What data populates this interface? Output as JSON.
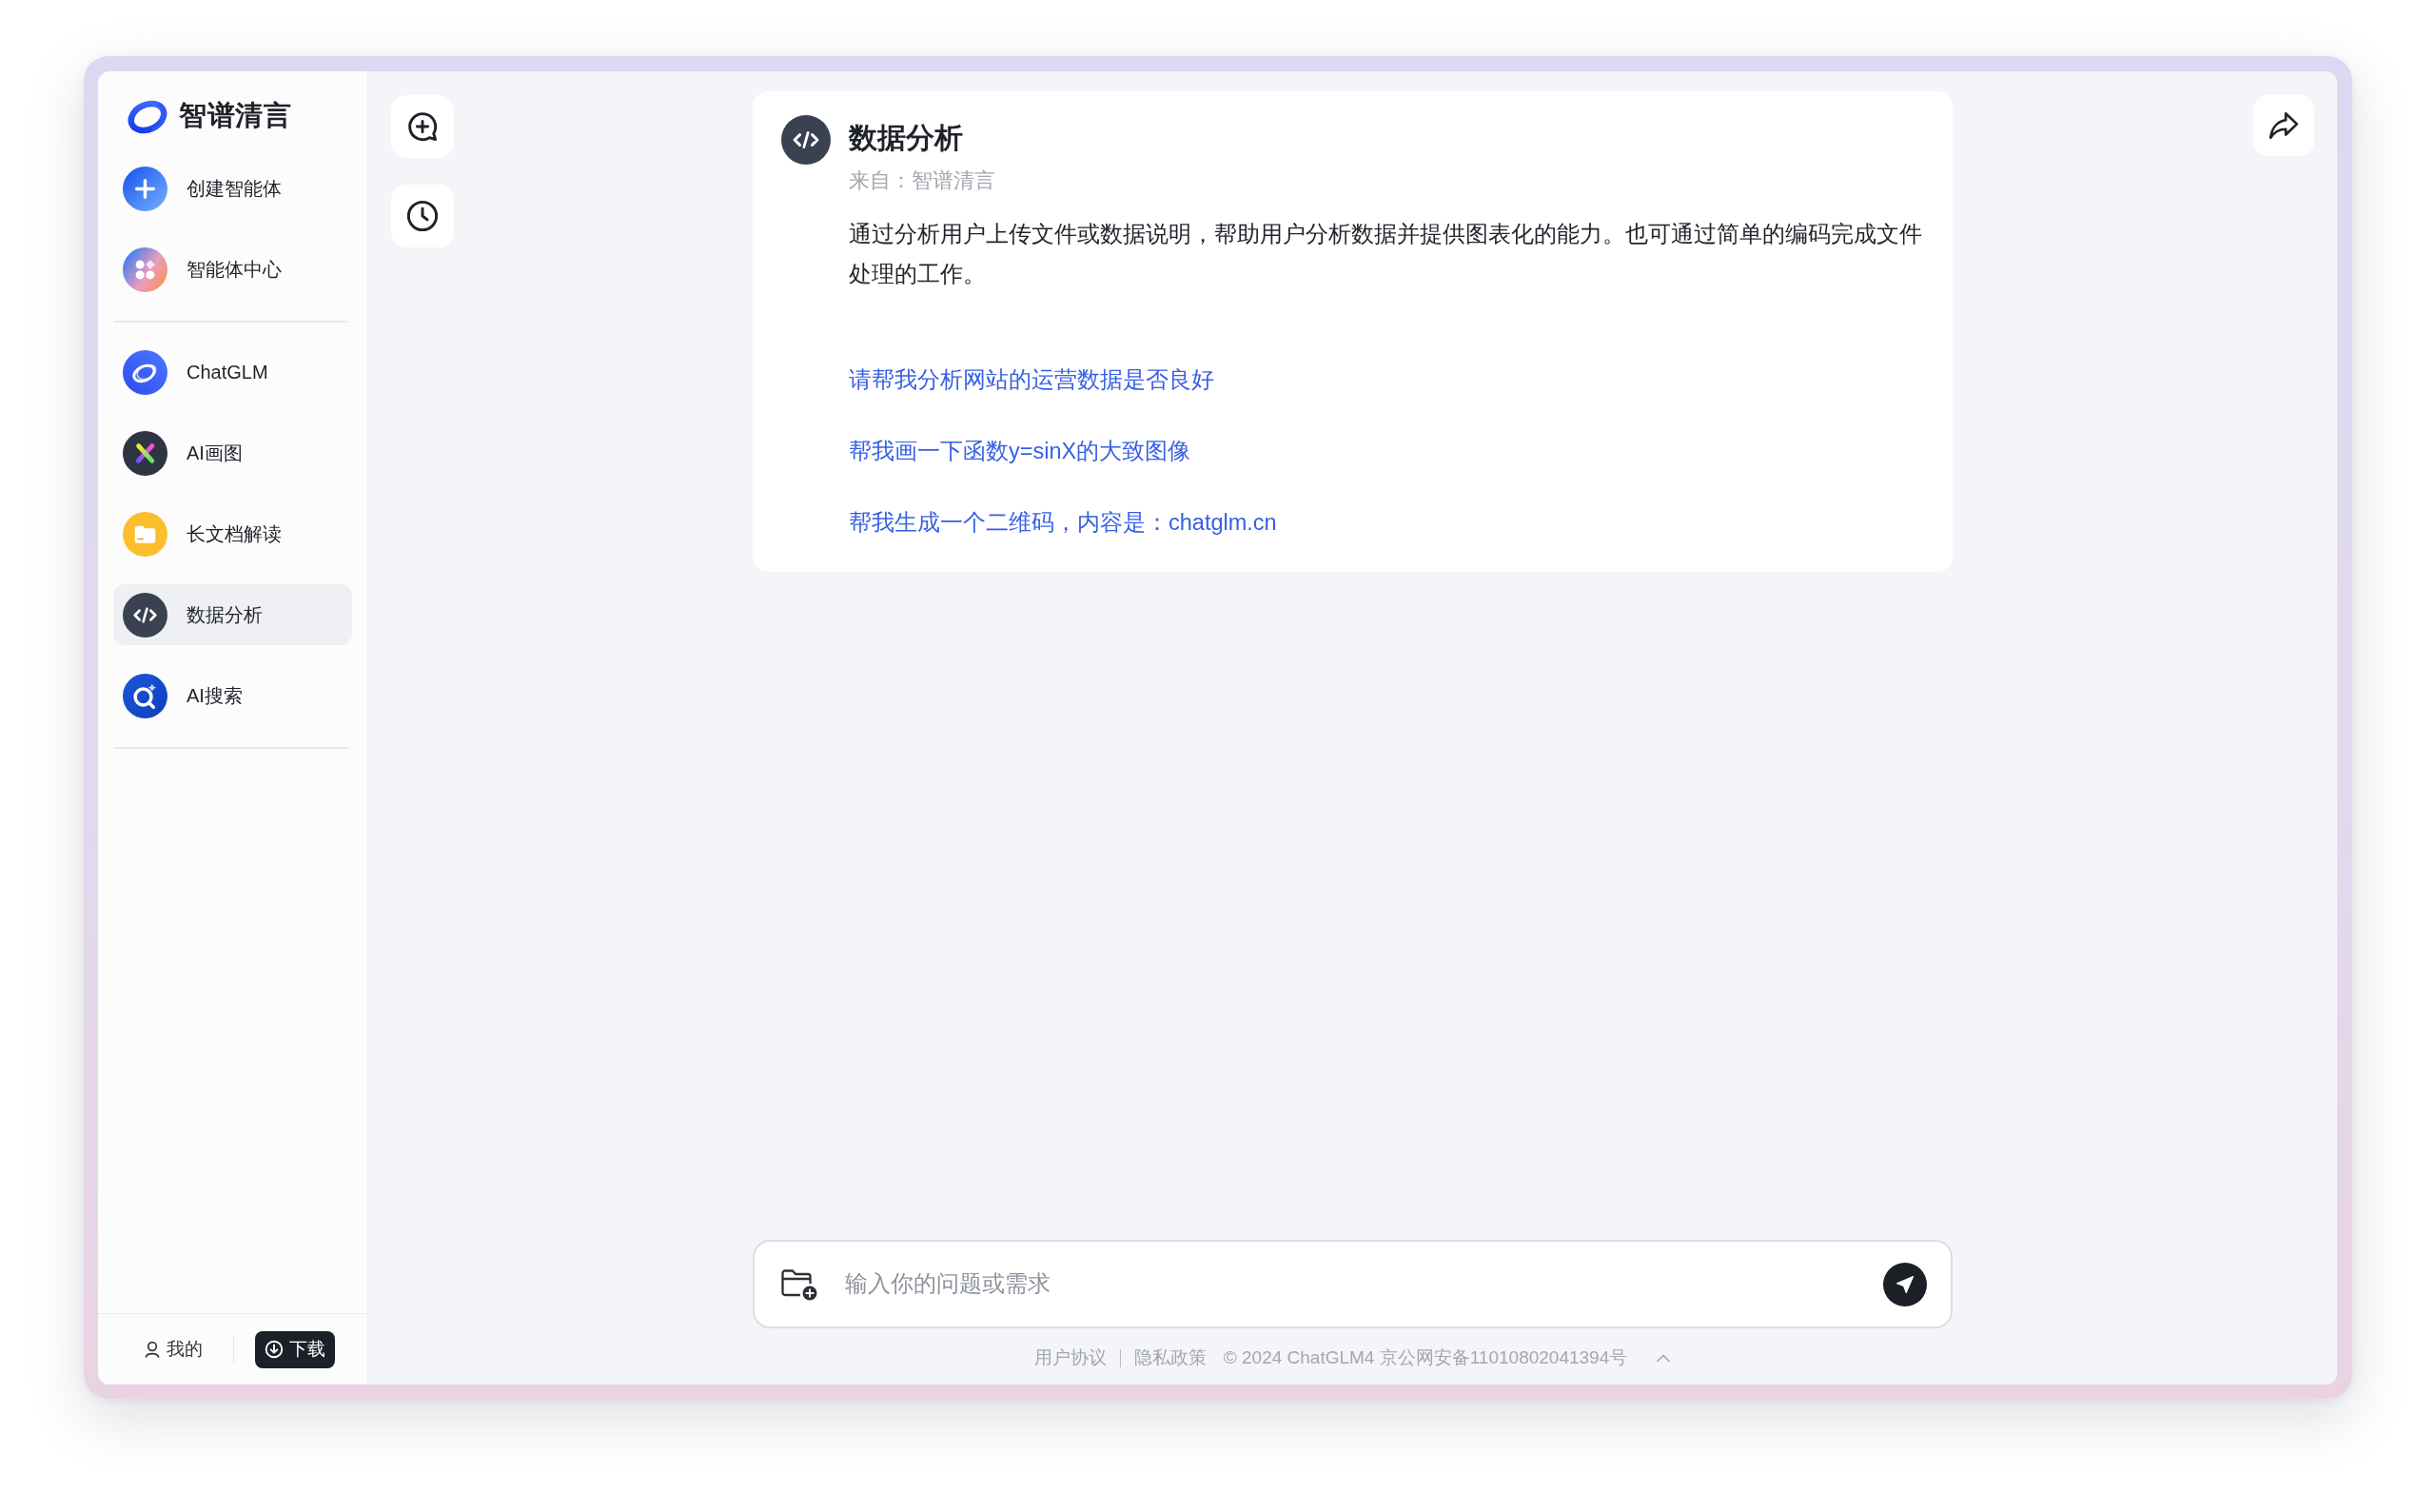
{
  "sidebar": {
    "logo": "智谱清言",
    "sections": [
      {
        "items": [
          {
            "label": "创建智能体",
            "selected": false
          },
          {
            "label": "智能体中心",
            "selected": false
          }
        ]
      },
      {
        "items": [
          {
            "label": "ChatGLM",
            "selected": false
          },
          {
            "label": "AI画图",
            "selected": false
          },
          {
            "label": "长文档解读",
            "selected": false
          },
          {
            "label": "数据分析",
            "selected": true
          },
          {
            "label": "AI搜索",
            "selected": false
          }
        ]
      }
    ],
    "footer": {
      "profile": "我的",
      "download": "下载"
    }
  },
  "agent": {
    "title": "数据分析",
    "source": "来自：智谱清言",
    "description": "通过分析用户上传文件或数据说明，帮助用户分析数据并提供图表化的能力。也可通过简单的编码完成文件处理的工作。",
    "suggestions": [
      "请帮我分析网站的运营数据是否良好",
      "帮我画一下函数y=sinX的大致图像",
      "帮我生成一个二维码，内容是：chatglm.cn"
    ]
  },
  "composer": {
    "placeholder": "输入你的问题或需求"
  },
  "footer": {
    "links": [
      "用户协议",
      "隐私政策"
    ],
    "copyright": "© 2024 ChatGLM4 京公网安备11010802041394号"
  }
}
